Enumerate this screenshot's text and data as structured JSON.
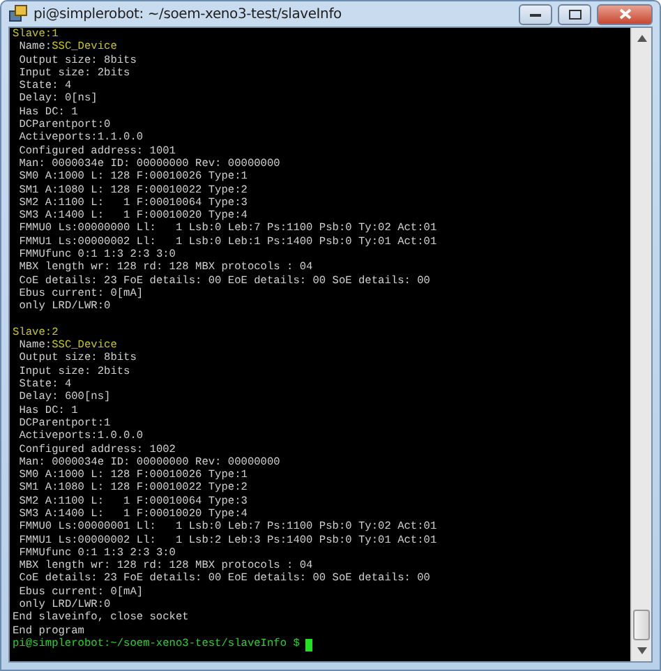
{
  "window": {
    "title": "pi@simplerobot: ~/soem-xeno3-test/slaveInfo"
  },
  "slaves": [
    {
      "heading": "Slave:1",
      "name_label": "Name:",
      "name_value": "SSC_Device",
      "lines": [
        "Output size: 8bits",
        "Input size: 2bits",
        "State: 4",
        "Delay: 0[ns]",
        "Has DC: 1",
        "DCParentport:0",
        "Activeports:1.1.0.0",
        "Configured address: 1001",
        "Man: 0000034e ID: 00000000 Rev: 00000000",
        "SM0 A:1000 L: 128 F:00010026 Type:1",
        "SM1 A:1080 L: 128 F:00010022 Type:2",
        "SM2 A:1100 L:   1 F:00010064 Type:3",
        "SM3 A:1400 L:   1 F:00010020 Type:4",
        "FMMU0 Ls:00000000 Ll:   1 Lsb:0 Leb:7 Ps:1100 Psb:0 Ty:02 Act:01",
        "FMMU1 Ls:00000002 Ll:   1 Lsb:0 Leb:1 Ps:1400 Psb:0 Ty:01 Act:01",
        "FMMUfunc 0:1 1:3 2:3 3:0",
        "MBX length wr: 128 rd: 128 MBX protocols : 04",
        "CoE details: 23 FoE details: 00 EoE details: 00 SoE details: 00",
        "Ebus current: 0[mA]",
        "only LRD/LWR:0"
      ]
    },
    {
      "heading": "Slave:2",
      "name_label": "Name:",
      "name_value": "SSC_Device",
      "lines": [
        "Output size: 8bits",
        "Input size: 2bits",
        "State: 4",
        "Delay: 600[ns]",
        "Has DC: 1",
        "DCParentport:1",
        "Activeports:1.0.0.0",
        "Configured address: 1002",
        "Man: 0000034e ID: 00000000 Rev: 00000000",
        "SM0 A:1000 L: 128 F:00010026 Type:1",
        "SM1 A:1080 L: 128 F:00010022 Type:2",
        "SM2 A:1100 L:   1 F:00010064 Type:3",
        "SM3 A:1400 L:   1 F:00010020 Type:4",
        "FMMU0 Ls:00000001 Ll:   1 Lsb:0 Leb:7 Ps:1100 Psb:0 Ty:02 Act:01",
        "FMMU1 Ls:00000002 Ll:   1 Lsb:2 Leb:3 Ps:1400 Psb:0 Ty:01 Act:01",
        "FMMUfunc 0:1 1:3 2:3 3:0",
        "MBX length wr: 128 rd: 128 MBX protocols : 04",
        "CoE details: 23 FoE details: 00 EoE details: 00 SoE details: 00",
        "Ebus current: 0[mA]",
        "only LRD/LWR:0"
      ]
    }
  ],
  "footer_lines": [
    "End slaveinfo, close socket",
    "End program"
  ],
  "prompt": {
    "text": "pi@simplerobot:~/soem-xeno3-test/slaveInfo $",
    "cursor": true
  }
}
